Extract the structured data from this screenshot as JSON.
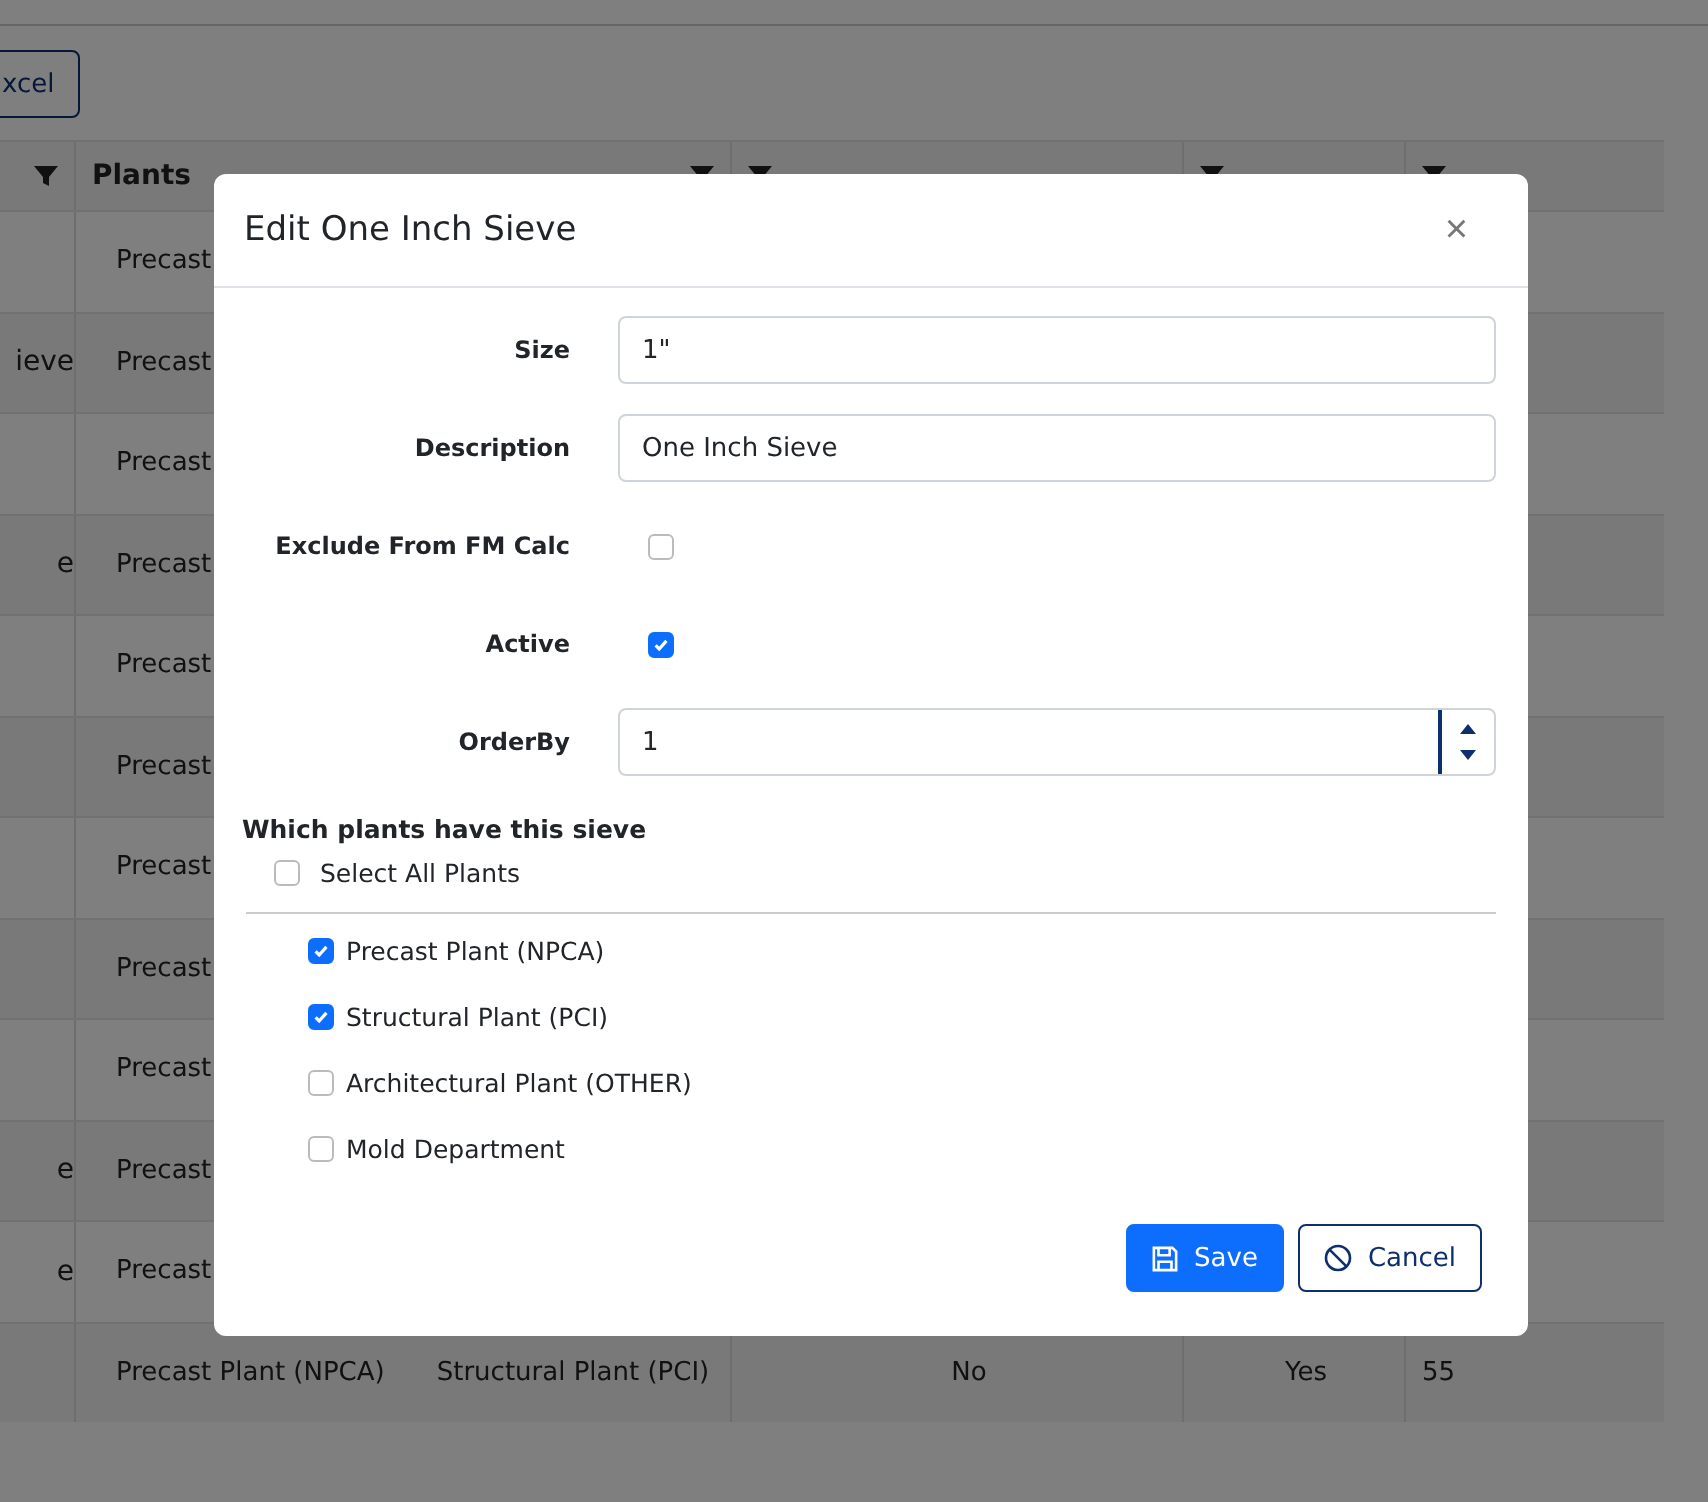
{
  "toolbar": {
    "export_button": "xcel"
  },
  "table": {
    "header": {
      "column_2": "Plants"
    },
    "rows": [
      {
        "column_1": "",
        "plants": [
          "Precast"
        ]
      },
      {
        "column_1": "ieve",
        "plants": [
          "Precast"
        ]
      },
      {
        "column_1": "",
        "plants": [
          "Precast"
        ]
      },
      {
        "column_1": "e",
        "plants": [
          "Precast"
        ]
      },
      {
        "column_1": "",
        "plants": [
          "Precast"
        ]
      },
      {
        "column_1": "",
        "plants": [
          "Precast"
        ]
      },
      {
        "column_1": "",
        "plants": [
          "Precast"
        ]
      },
      {
        "column_1": "",
        "plants": [
          "Precast"
        ]
      },
      {
        "column_1": "",
        "plants": [
          "Precast"
        ]
      },
      {
        "column_1": "e",
        "plants": [
          "Precast"
        ]
      },
      {
        "column_1": "e",
        "plants": [
          "Precast"
        ]
      },
      {
        "column_1": "",
        "plants": [
          "Precast Plant (NPCA)",
          "Structural Plant (PCI)"
        ],
        "exclude": "No",
        "active": "Yes",
        "order_by": "55"
      }
    ]
  },
  "dialog": {
    "title": "Edit One Inch Sieve",
    "close": "×",
    "fields": [
      {
        "kind": "text",
        "label": "Size",
        "value": "1\""
      },
      {
        "kind": "text",
        "label": "Description",
        "value": "One Inch Sieve"
      },
      {
        "kind": "checkbox",
        "label": "Exclude From FM Calc",
        "checked": false
      },
      {
        "kind": "checkbox",
        "label": "Active",
        "checked": true
      },
      {
        "kind": "number",
        "label": "OrderBy",
        "value": "1"
      }
    ],
    "plants_heading": "Which plants have this sieve",
    "select_all": {
      "label": "Select All Plants",
      "checked": false
    },
    "plants": [
      {
        "label": "Precast Plant (NPCA)",
        "checked": true
      },
      {
        "label": "Structural Plant (PCI)",
        "checked": true
      },
      {
        "label": "Architectural Plant (OTHER)",
        "checked": false
      },
      {
        "label": "Mold Department",
        "checked": false
      }
    ],
    "buttons": [
      {
        "kind": "primary",
        "label": "Save"
      },
      {
        "kind": "secondary",
        "label": "Cancel"
      }
    ]
  }
}
